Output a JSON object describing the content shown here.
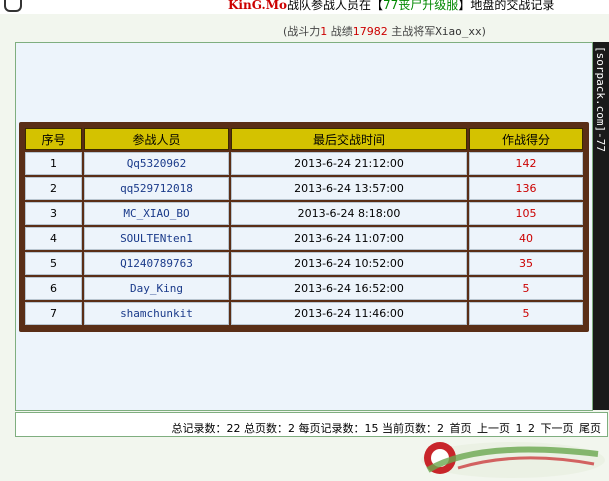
{
  "header": {
    "clan_name": "KinG.Mo",
    "title_part1": "战队参战人员在",
    "bracket_open": "【",
    "server_name": "77丧尸升级服",
    "bracket_close": "】",
    "title_part2": "地盘的交战记录"
  },
  "stats": {
    "open": "(",
    "power_label": "战斗力",
    "power_value": "1",
    "score_label": "战绩",
    "score_value": "17982",
    "general_label": "主战将军",
    "general_name": "Xiao_xx",
    "close": ")"
  },
  "table": {
    "columns": [
      "序号",
      "参战人员",
      "最后交战时间",
      "作战得分"
    ],
    "rows": [
      {
        "idx": "1",
        "player": "Qq5320962",
        "time": "2013-6-24 21:12:00",
        "score": "142"
      },
      {
        "idx": "2",
        "player": "qq529712018",
        "time": "2013-6-24 13:57:00",
        "score": "136"
      },
      {
        "idx": "3",
        "player": "MC_XIAO_BO",
        "time": "2013-6-24 8:18:00",
        "score": "105"
      },
      {
        "idx": "4",
        "player": "SOULTENten1",
        "time": "2013-6-24 11:07:00",
        "score": "40"
      },
      {
        "idx": "5",
        "player": "Q1240789763",
        "time": "2013-6-24 10:52:00",
        "score": "35"
      },
      {
        "idx": "6",
        "player": "Day_King",
        "time": "2013-6-24 16:52:00",
        "score": "5"
      },
      {
        "idx": "7",
        "player": "shamchunkit",
        "time": "2013-6-24 11:46:00",
        "score": "5"
      }
    ]
  },
  "pager": {
    "summary": "总记录数：22 总页数：2 每页记录数：15 当前页数：2",
    "first": "首页",
    "prev": "上一页",
    "page1": "1",
    "page2": "2",
    "next": "下一页",
    "last": "尾页"
  },
  "sidebar": {
    "text": "[sorpack.com]-77"
  },
  "colors": {
    "header_cell": "#d4c200",
    "table_border": "#5a2e16",
    "score": "#cc0000",
    "player": "#1a3a8a"
  }
}
